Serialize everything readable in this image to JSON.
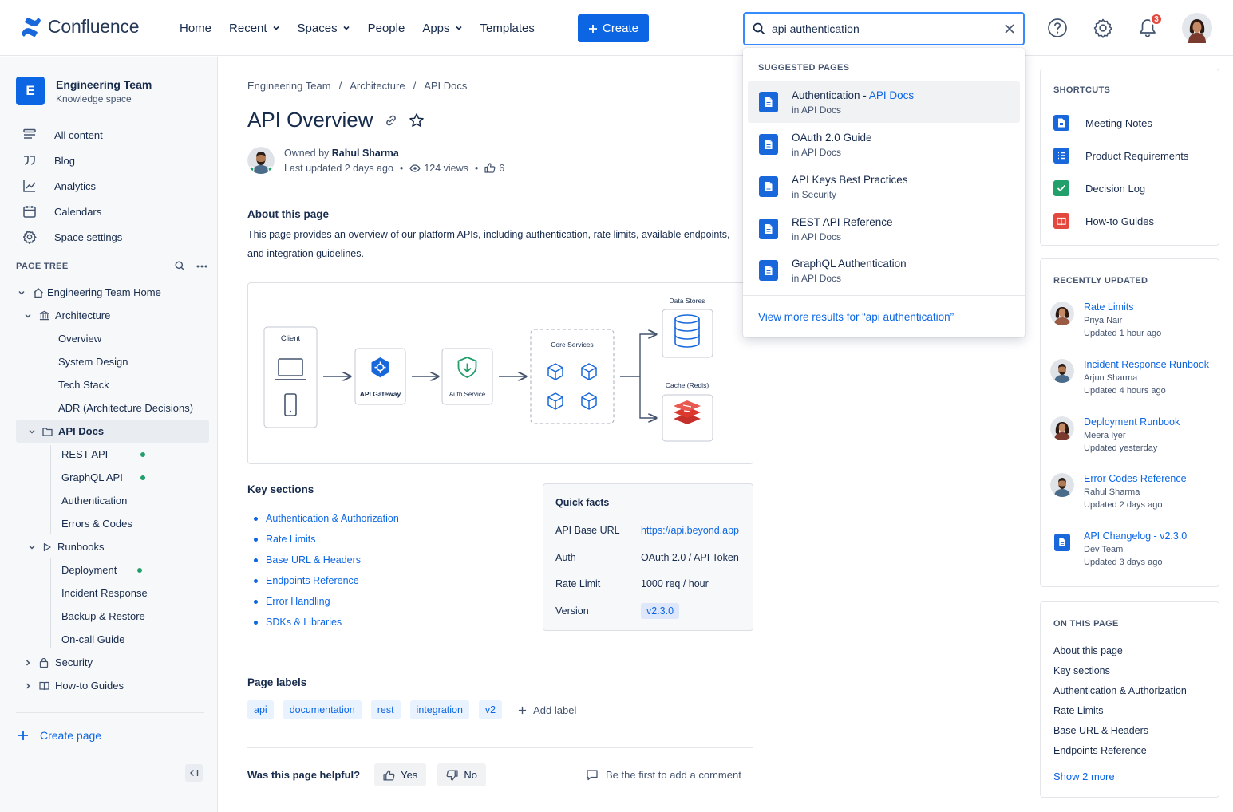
{
  "app": {
    "name": "Confluence"
  },
  "nav": {
    "items": [
      {
        "label": "Home",
        "has_chevron": false
      },
      {
        "label": "Recent",
        "has_chevron": true
      },
      {
        "label": "Spaces",
        "has_chevron": true
      },
      {
        "label": "People",
        "has_chevron": false
      },
      {
        "label": "Apps",
        "has_chevron": true
      },
      {
        "label": "Templates",
        "has_chevron": false
      }
    ],
    "create_label": "Create",
    "notification_count": "3"
  },
  "search": {
    "value": "api authentication",
    "suggested_header": "SUGGESTED PAGES",
    "results": [
      {
        "title_plain": "Authentication - ",
        "title_hl": "API Docs",
        "location": "in API Docs"
      },
      {
        "title_plain": "OAuth 2.0 Guide",
        "title_hl": "",
        "location": "in API Docs"
      },
      {
        "title_plain": "API Keys Best Practices",
        "title_hl": "",
        "location": "in Security"
      },
      {
        "title_plain": "REST API Reference",
        "title_hl": "",
        "location": "in API Docs"
      },
      {
        "title_plain": "GraphQL Authentication",
        "title_hl": "",
        "location": "in API Docs"
      }
    ],
    "view_more": "View more results for “api authentication”"
  },
  "sidebar": {
    "space_letter": "E",
    "space_name": "Engineering Team",
    "space_type": "Knowledge space",
    "nav": [
      {
        "label": "All content",
        "icon": "list-icon"
      },
      {
        "label": "Blog",
        "icon": "quote-icon"
      },
      {
        "label": "Analytics",
        "icon": "chart-icon"
      },
      {
        "label": "Calendars",
        "icon": "calendar-icon"
      },
      {
        "label": "Space settings",
        "icon": "gear-icon"
      }
    ],
    "page_tree_label": "PAGE TREE",
    "tree": [
      {
        "label": "Engineering Team Home"
      },
      {
        "label": "Architecture"
      },
      {
        "label": "Overview"
      },
      {
        "label": "System Design"
      },
      {
        "label": "Tech Stack"
      },
      {
        "label": "ADR (Architecture Decisions)"
      },
      {
        "label": "API Docs"
      },
      {
        "label": "REST API"
      },
      {
        "label": "GraphQL API"
      },
      {
        "label": "Authentication"
      },
      {
        "label": "Errors & Codes"
      },
      {
        "label": "Runbooks"
      },
      {
        "label": "Deployment"
      },
      {
        "label": "Incident Response"
      },
      {
        "label": "Backup & Restore"
      },
      {
        "label": "On-call Guide"
      },
      {
        "label": "Security"
      },
      {
        "label": "How-to Guides"
      }
    ],
    "create_page": "Create page"
  },
  "page": {
    "breadcrumb": [
      "Engineering Team",
      "Architecture",
      "API Docs"
    ],
    "title": "API Overview",
    "owned_by_prefix": "Owned by",
    "owner": "Rahul Sharma",
    "last_updated": "Last updated 2 days ago",
    "views": "124 views",
    "likes": "6",
    "about_heading": "About this page",
    "about_text": "This page provides an overview of our platform APIs, including authentication, rate limits, available endpoints, and integration guidelines.",
    "diagram": {
      "client": "Client",
      "gateway": "API Gateway",
      "auth": "Auth Service",
      "core": "Core Services",
      "data_stores": "Data Stores",
      "cache": "Cache (Redis)"
    },
    "key_sections_heading": "Key sections",
    "key_sections": [
      "Authentication & Authorization",
      "Rate Limits",
      "Base URL & Headers",
      "Endpoints Reference",
      "Error Handling",
      "SDKs & Libraries"
    ],
    "quick_facts": {
      "heading": "Quick facts",
      "rows": [
        {
          "k": "API Base URL",
          "v": "https://api.beyond.app"
        },
        {
          "k": "Auth",
          "v": "OAuth 2.0 / API Token"
        },
        {
          "k": "Rate Limit",
          "v": "1000 req / hour"
        },
        {
          "k": "Version",
          "v": "v2.3.0"
        }
      ]
    },
    "labels_heading": "Page labels",
    "labels": [
      "api",
      "documentation",
      "rest",
      "integration",
      "v2"
    ],
    "add_label": "Add label",
    "helpful_q": "Was this page helpful?",
    "yes": "Yes",
    "no": "No",
    "comment_prompt": "Be the first to add a comment"
  },
  "rail": {
    "shortcuts_heading": "SHORTCUTS",
    "shortcuts": [
      {
        "label": "Meeting Notes",
        "color": "#1868db"
      },
      {
        "label": "Product Requirements",
        "color": "#1868db"
      },
      {
        "label": "Decision Log",
        "color": "#22a06b"
      },
      {
        "label": "How-to Guides",
        "color": "#e2483d"
      }
    ],
    "recent_heading": "RECENTLY UPDATED",
    "recent": [
      {
        "title": "Rate Limits",
        "by": "Priya Nair",
        "time": "Updated 1 hour ago"
      },
      {
        "title": "Incident Response Runbook",
        "by": "Arjun Sharma",
        "time": "Updated 4 hours ago"
      },
      {
        "title": "Deployment Runbook",
        "by": "Meera Iyer",
        "time": "Updated yesterday"
      },
      {
        "title": "Error Codes Reference",
        "by": "Rahul Sharma",
        "time": "Updated 2 days ago"
      },
      {
        "title": "API Changelog - v2.3.0",
        "by": "Dev Team",
        "time": "Updated 3 days ago"
      }
    ],
    "otp_heading": "ON THIS PAGE",
    "otp": [
      "About this page",
      "Key sections",
      "Authentication & Authorization",
      "Rate Limits",
      "Base URL & Headers",
      "Endpoints Reference"
    ],
    "otp_more": "Show 2 more"
  },
  "colors": {
    "primary": "#0c66e4",
    "text": "#172b4d",
    "subtle": "#44546f",
    "success": "#22a06b",
    "danger": "#e2483d"
  }
}
